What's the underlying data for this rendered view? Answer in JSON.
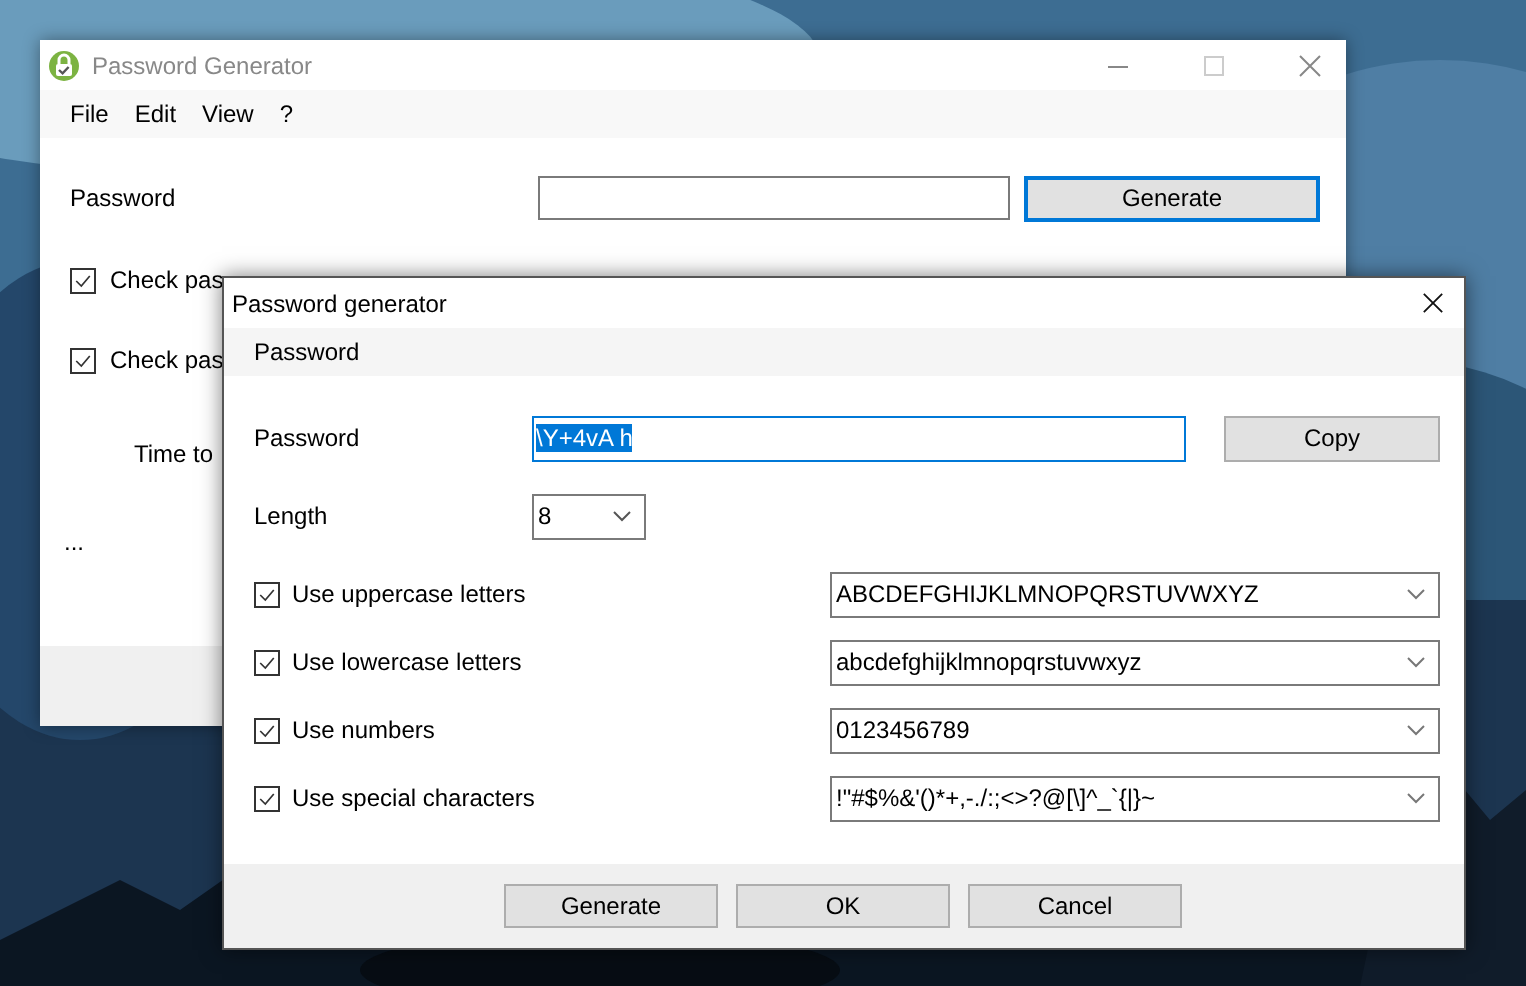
{
  "main_window": {
    "title": "Password Generator",
    "menu": [
      "File",
      "Edit",
      "View",
      "?"
    ],
    "password_label": "Password",
    "generate_button": "Generate",
    "generate_focused": true,
    "checks": [
      {
        "label": "Check pas",
        "checked": true
      },
      {
        "label": "Check pas",
        "checked": true
      }
    ],
    "time_label": "Time to",
    "ellipsis": "..."
  },
  "dialog": {
    "title": "Password generator",
    "section": "Password",
    "password_label": "Password",
    "password_value": "\\Y+4vA h",
    "password_text_selected": true,
    "copy_button": "Copy",
    "length_label": "Length",
    "length_value": "8",
    "options": [
      {
        "label": "Use uppercase letters",
        "checked": true,
        "charset": "ABCDEFGHIJKLMNOPQRSTUVWXYZ"
      },
      {
        "label": "Use lowercase letters",
        "checked": true,
        "charset": "abcdefghijklmnopqrstuvwxyz"
      },
      {
        "label": "Use numbers",
        "checked": true,
        "charset": "0123456789"
      },
      {
        "label": "Use special characters",
        "checked": true,
        "charset": "!\"#$%&'()*+,-./:;<>?@[\\]^_`{|}~"
      }
    ],
    "buttons": [
      "Generate",
      "OK",
      "Cancel"
    ]
  }
}
